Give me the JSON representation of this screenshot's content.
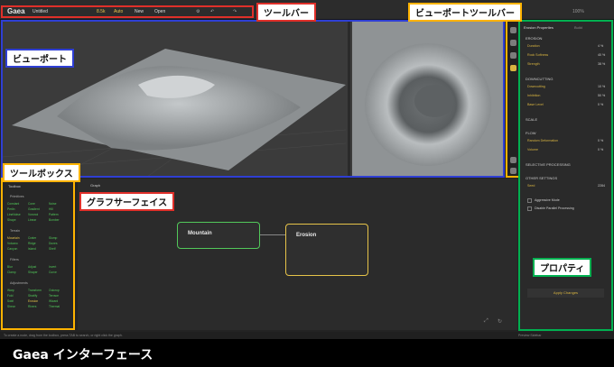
{
  "toolbar": {
    "app_name": "Gaea",
    "project": "Untitled",
    "res_label": "8.5k",
    "auto_label": "Auto",
    "new_label": "New",
    "open_label": "Open",
    "right_info": "100%"
  },
  "viewport_toolbar": {
    "icons": [
      "layers-icon",
      "target-icon",
      "sun-icon",
      "grid-icon",
      "camera-icon",
      "settings-icon"
    ]
  },
  "toolbox": {
    "title": "Toolbox",
    "categories": [
      {
        "name": "Primitives",
        "nodes": [
          [
            "Constant",
            "Cone",
            "Noise"
          ],
          [
            "Perlin",
            "Gradient",
            "Hill"
          ],
          [
            "LineNoise",
            "Voronoi",
            "Pattern"
          ],
          [
            "Shape",
            "Linear",
            "Bomber"
          ]
        ]
      },
      {
        "name": "Terrain",
        "nodes": [
          [
            "Mountain",
            "Crater",
            "Slump"
          ],
          [
            "Volcano",
            "Ridge",
            "Dunes"
          ],
          [
            "Canyon",
            "Island",
            "Shelf"
          ]
        ]
      },
      {
        "name": "Filters",
        "nodes": [
          [
            "Blur",
            "Adjust",
            "Invert"
          ],
          [
            "Clamp",
            "Shaper",
            "Curve"
          ]
        ]
      },
      {
        "name": "Adjustments",
        "nodes": [
          [
            "Warp",
            "Transform",
            "Outcrop"
          ],
          [
            "Fold",
            "Stratify",
            "Terrace"
          ],
          [
            "Swirl",
            "Erosion",
            "Wizard"
          ],
          [
            "Shear",
            "Rivers",
            "Thermal"
          ]
        ]
      }
    ]
  },
  "graph": {
    "title": "Graph",
    "nodes": [
      {
        "name": "Mountain"
      },
      {
        "name": "Erosion"
      }
    ]
  },
  "properties": {
    "title": "Erosion Properties",
    "tab2": "Build",
    "sections": [
      {
        "name": "EROSION",
        "rows": [
          {
            "label": "Duration",
            "value": "4 %"
          },
          {
            "label": "Rock Softness",
            "value": "40 %"
          },
          {
            "label": "Strength",
            "value": "38 %"
          }
        ]
      },
      {
        "name": "DOWNCUTTING",
        "rows": [
          {
            "label": "Downcutting",
            "value": "10 %"
          },
          {
            "label": "Inhibition",
            "value": "50 %"
          },
          {
            "label": "Base Level",
            "value": "0 %"
          }
        ]
      },
      {
        "name": "SCALE",
        "rows": []
      },
      {
        "name": "FLOW",
        "rows": [
          {
            "label": "Random Deformation",
            "value": "0 %"
          },
          {
            "label": "Volume",
            "value": "0 %"
          }
        ]
      },
      {
        "name": "SELECTIVE PROCESSING",
        "rows": []
      },
      {
        "name": "OTHER SETTINGS",
        "rows": [
          {
            "label": "Seed",
            "value": "2284"
          }
        ]
      }
    ],
    "checkboxes": [
      "Aggressive Mode",
      "Disable Parallel Processing"
    ],
    "apply_label": "Apply Changes"
  },
  "status": {
    "text": "To create a node, drag from the toolbox, press TAB to search, or right click the graph.",
    "right": "Preview Sidebar"
  },
  "annotations": {
    "toolbar": "ツールバー",
    "viewport_toolbar": "ビューポートツールバー",
    "viewport": "ビューポート",
    "toolbox": "ツールボックス",
    "graph": "グラフサーフェイス",
    "properties": "プロパティ"
  },
  "caption": "Gaea インターフェース",
  "colors": {
    "red": "#e0302a",
    "blue": "#2f3fd4",
    "orange": "#ffb300",
    "green": "#00b050",
    "node_green": "#52c85a",
    "node_yellow": "#e6c349"
  }
}
